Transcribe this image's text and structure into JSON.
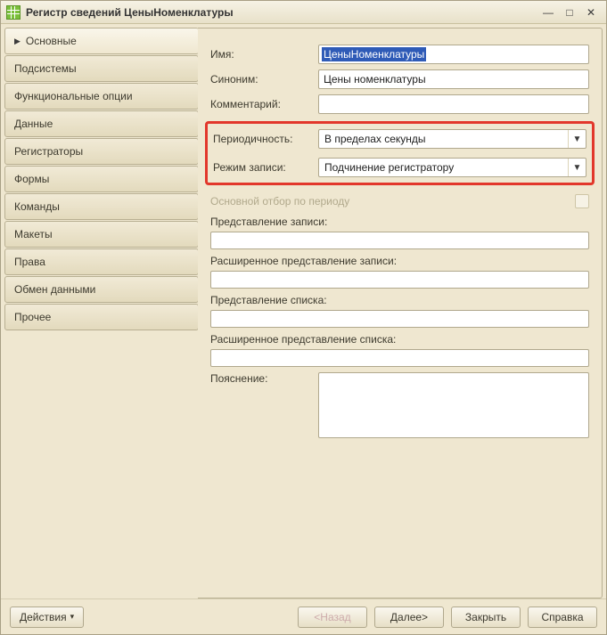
{
  "window": {
    "title": "Регистр сведений ЦеныНоменклатуры"
  },
  "sidebar": {
    "items": [
      {
        "label": "Основные",
        "active": true
      },
      {
        "label": "Подсистемы"
      },
      {
        "label": "Функциональные опции"
      },
      {
        "label": "Данные"
      },
      {
        "label": "Регистраторы"
      },
      {
        "label": "Формы"
      },
      {
        "label": "Команды"
      },
      {
        "label": "Макеты"
      },
      {
        "label": "Права"
      },
      {
        "label": "Обмен данными"
      },
      {
        "label": "Прочее"
      }
    ]
  },
  "form": {
    "name_label": "Имя:",
    "name_value": "ЦеныНоменклатуры",
    "synonym_label": "Синоним:",
    "synonym_value": "Цены номенклатуры",
    "comment_label": "Комментарий:",
    "comment_value": "",
    "periodicity_label": "Периодичность:",
    "periodicity_value": "В пределах секунды",
    "write_mode_label": "Режим записи:",
    "write_mode_value": "Подчинение регистратору",
    "main_filter_label": "Основной отбор по периоду",
    "record_presentation_label": "Представление записи:",
    "record_presentation_value": "",
    "ext_record_presentation_label": "Расширенное представление записи:",
    "ext_record_presentation_value": "",
    "list_presentation_label": "Представление списка:",
    "list_presentation_value": "",
    "ext_list_presentation_label": "Расширенное представление списка:",
    "ext_list_presentation_value": "",
    "explanation_label": "Пояснение:",
    "explanation_value": ""
  },
  "footer": {
    "actions": "Действия",
    "back": "<Назад",
    "next": "Далее>",
    "close": "Закрыть",
    "help": "Справка"
  }
}
